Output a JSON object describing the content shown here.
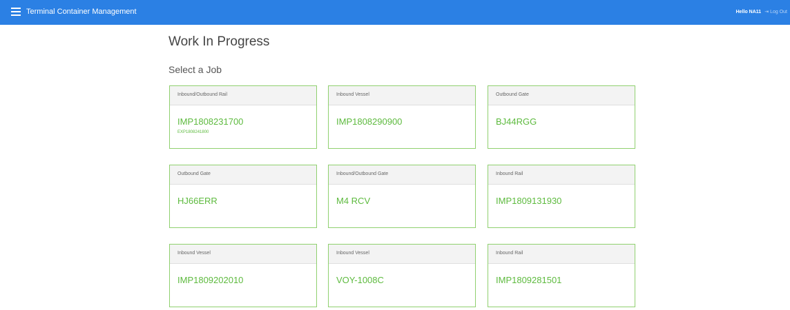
{
  "app": {
    "title": "Terminal Container Management"
  },
  "user": {
    "greeting": "Hello NA11",
    "logout_label": "Log Out"
  },
  "page": {
    "title": "Work In Progress",
    "subtitle": "Select a Job"
  },
  "jobs": [
    {
      "type": "Inbound/Outbound Rail",
      "ref": "IMP1808231700",
      "sub": "EXP1808241800"
    },
    {
      "type": "Inbound Vessel",
      "ref": "IMP1808290900",
      "sub": ""
    },
    {
      "type": "Outbound Gate",
      "ref": "BJ44RGG",
      "sub": ""
    },
    {
      "type": "Outbound Gate",
      "ref": "HJ66ERR",
      "sub": ""
    },
    {
      "type": "Inbound/Outbound Gate",
      "ref": "M4 RCV",
      "sub": ""
    },
    {
      "type": "Inbound Rail",
      "ref": "IMP1809131930",
      "sub": ""
    },
    {
      "type": "Inbound Vessel",
      "ref": "IMP1809202010",
      "sub": ""
    },
    {
      "type": "Inbound Vessel",
      "ref": "VOY-1008C",
      "sub": ""
    },
    {
      "type": "Inbound Rail",
      "ref": "IMP1809281501",
      "sub": ""
    }
  ],
  "colors": {
    "navbar": "#2b80e4",
    "card_border": "#8fd06e",
    "card_text": "#5dba3e"
  },
  "icons": {
    "menu": "hamburger-icon",
    "logout": "logout-icon"
  }
}
